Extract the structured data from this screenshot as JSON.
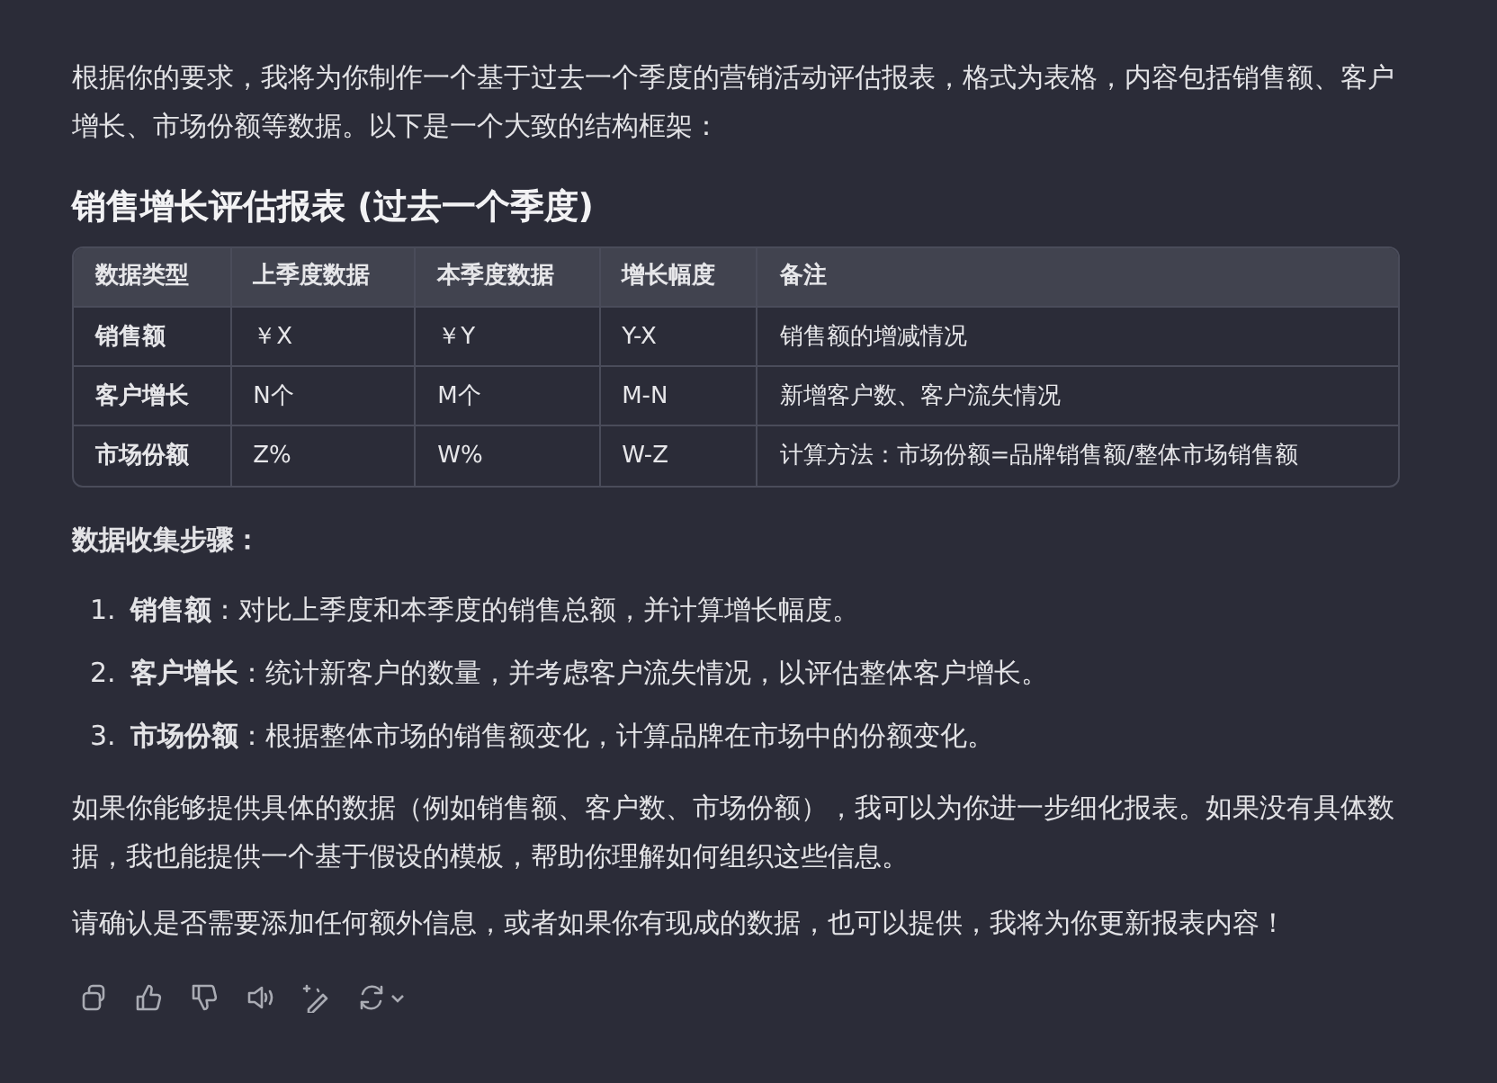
{
  "intro": "根据你的要求，我将为你制作一个基于过去一个季度的营销活动评估报表，格式为表格，内容包括销售额、客户增长、市场份额等数据。以下是一个大致的结构框架：",
  "heading": "销售增长评估报表 (过去一个季度)",
  "table": {
    "columns": [
      "数据类型",
      "上季度数据",
      "本季度数据",
      "增长幅度",
      "备注"
    ],
    "rows": [
      [
        "销售额",
        "￥X",
        "￥Y",
        "Y-X",
        "销售额的增减情况"
      ],
      [
        "客户增长",
        "N个",
        "M个",
        "M-N",
        "新增客户数、客户流失情况"
      ],
      [
        "市场份额",
        "Z%",
        "W%",
        "W-Z",
        "计算方法：市场份额=品牌销售额/整体市场销售额"
      ]
    ]
  },
  "steps_title": "数据收集步骤：",
  "steps": [
    {
      "number": "1.",
      "text": "**销售额**：对比上季度和本季度的销售总额，并计算增长幅度。"
    },
    {
      "number": "2.",
      "text": "**客户增长**：统计新客户的数量，并考虑客户流失情况，以评估整体客户增长。"
    },
    {
      "number": "3.",
      "text": "**市场份额**：根据整体市场的销售额变化，计算品牌在市场中的份额变化。"
    }
  ],
  "paragraphs": [
    "如果你能够提供具体的数据（例如销售额、客户数、市场份额），我可以为你进一步细化报表。如果没有具体数据，我也能提供一个基于假设的模板，帮助你理解如何组织这些信息。",
    "请确认是否需要添加任何额外信息，或者如果你有现成的数据，也可以提供，我将为你更新报表内容！"
  ],
  "actions": [
    {
      "kind": "copy"
    },
    {
      "kind": "like"
    },
    {
      "kind": "dislike"
    },
    {
      "kind": "speak"
    },
    {
      "kind": "edit"
    },
    {
      "kind": "regenerate"
    }
  ]
}
